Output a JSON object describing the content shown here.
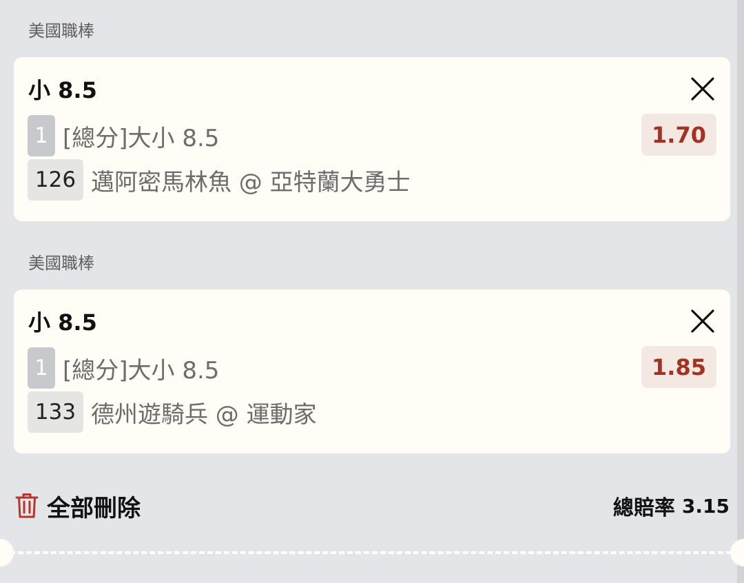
{
  "bets": [
    {
      "league": "美國職棒",
      "selection": "小 8.5",
      "leg_number": "1",
      "market": "[總分]大小 8.5",
      "match_id": "126",
      "match": "邁阿密馬林魚 @ 亞特蘭大勇士",
      "odds": "1.70",
      "close_icon": "close-icon"
    },
    {
      "league": "美國職棒",
      "selection": "小 8.5",
      "leg_number": "1",
      "market": "[總分]大小 8.5",
      "match_id": "133",
      "match": "德州遊騎兵 @ 運動家",
      "odds": "1.85",
      "close_icon": "close-icon"
    }
  ],
  "footer": {
    "delete_all_label": "全部刪除",
    "delete_icon": "trash-icon",
    "total_odds_label": "總賠率",
    "total_odds_value": "3.15"
  },
  "colors": {
    "background": "#e4e5e8",
    "card": "#fffdf5",
    "odds_text": "#a43222",
    "odds_bg": "#f4e8e2",
    "trash_icon": "#b8332a"
  }
}
